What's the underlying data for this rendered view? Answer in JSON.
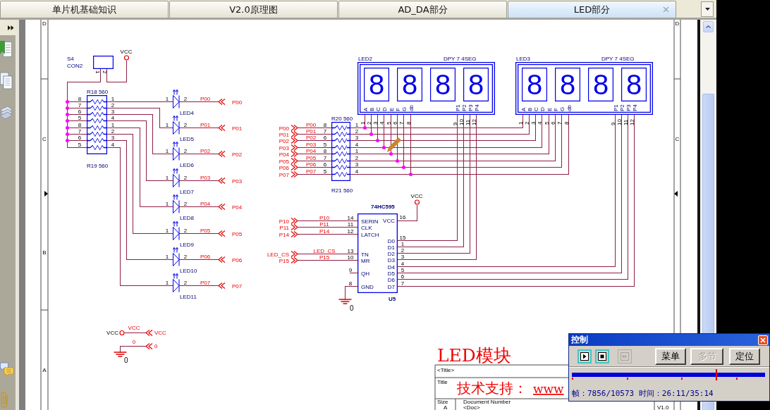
{
  "tabs": [
    {
      "label": "单片机基础知识",
      "selected": false
    },
    {
      "label": "V2.0原理图",
      "selected": false
    },
    {
      "label": "AD_DA部分",
      "selected": false
    },
    {
      "label": "LED部分",
      "selected": true
    }
  ],
  "schematic": {
    "zones": {
      "left": [
        "D",
        "C",
        "B",
        "A"
      ],
      "right": [
        "D",
        "C"
      ]
    },
    "connector": {
      "ref": "S4",
      "part": "CON2",
      "pins": [
        "1",
        "2"
      ],
      "power": "VCC"
    },
    "led_network": {
      "top_label": "R18 560",
      "bottom_label": "R19 560",
      "left_pins": [
        "8",
        "7",
        "6",
        "5",
        "8",
        "7",
        "6",
        "5"
      ],
      "right_pins": [
        "1",
        "2",
        "3",
        "4",
        "1",
        "2",
        "3",
        "4"
      ]
    },
    "leds": [
      {
        "ref": "LED4",
        "pin_a": "1",
        "pin_k": "2",
        "net": "P00",
        "port": "P00"
      },
      {
        "ref": "LED5",
        "pin_a": "1",
        "pin_k": "2",
        "net": "P01",
        "port": "P01"
      },
      {
        "ref": "LED6",
        "pin_a": "1",
        "pin_k": "2",
        "net": "P02",
        "port": "P02"
      },
      {
        "ref": "LED7",
        "pin_a": "1",
        "pin_k": "2",
        "net": "P03",
        "port": "P03"
      },
      {
        "ref": "LED8",
        "pin_a": "1",
        "pin_k": "2",
        "net": "P04",
        "port": "P04"
      },
      {
        "ref": "LED9",
        "pin_a": "1",
        "pin_k": "2",
        "net": "P05",
        "port": "P05"
      },
      {
        "ref": "LED10",
        "pin_a": "1",
        "pin_k": "2",
        "net": "P06",
        "port": "P06"
      },
      {
        "ref": "LED11",
        "pin_a": "1",
        "pin_k": "2",
        "net": "P07",
        "port": "P07"
      }
    ],
    "segment_network": {
      "top_label": "R20 560",
      "bottom_label": "R21 560",
      "left_pins": [
        "8",
        "7",
        "6",
        "5",
        "8",
        "7",
        "6",
        "5"
      ],
      "right_pins": [
        "1",
        "2",
        "3",
        "4",
        "1",
        "2",
        "3",
        "4"
      ]
    },
    "segment_inputs": [
      {
        "port": "P00",
        "net": "P00"
      },
      {
        "port": "P01",
        "net": "P01"
      },
      {
        "port": "P02",
        "net": "P02"
      },
      {
        "port": "P03",
        "net": "P03"
      },
      {
        "port": "P04",
        "net": "P04"
      },
      {
        "port": "P05",
        "net": "P05"
      },
      {
        "port": "P06",
        "net": "P06"
      },
      {
        "port": "P07",
        "net": "P07"
      }
    ],
    "displays": [
      {
        "ref": "LED2",
        "part": "DPY 7 4SEG",
        "digits": [
          "8",
          "8",
          "8",
          "8"
        ],
        "segment_pins": [
          "A",
          "B",
          "C",
          "D",
          "E",
          "F",
          "G",
          "db"
        ],
        "segment_numbers": [
          "1",
          "2",
          "3",
          "4",
          "5",
          "6",
          "7",
          "8"
        ],
        "digit_pins": [
          "P1",
          "P2",
          "P3",
          "P4"
        ],
        "digit_numbers": [
          "9",
          "10",
          "11",
          "12"
        ]
      },
      {
        "ref": "LED3",
        "part": "DPY 7 4SEG",
        "digits": [
          "8",
          "8",
          "8",
          "8"
        ],
        "segment_pins": [
          "A",
          "B",
          "C",
          "D",
          "E",
          "F",
          "G",
          "db"
        ],
        "segment_numbers": [
          "1",
          "2",
          "3",
          "4",
          "5",
          "6",
          "7",
          "8"
        ],
        "digit_pins": [
          "P1",
          "P2",
          "P3",
          "P4"
        ],
        "digit_numbers": [
          "9",
          "10",
          "11",
          "12"
        ]
      }
    ],
    "shift_register": {
      "part": "74HC595",
      "ref": "U5",
      "power": "VCC",
      "ground": "0",
      "inputs": [
        {
          "number": "14",
          "name": "SERIN",
          "net": "P10",
          "port": "P10"
        },
        {
          "number": "11",
          "name": "CLK",
          "net": "P11",
          "port": "P11"
        },
        {
          "number": "12",
          "name": "LATCH",
          "net": "P14",
          "port": "P14"
        },
        {
          "number": "13",
          "name": "TN",
          "net": "LED_CS",
          "port": "LED_CS"
        },
        {
          "number": "10",
          "name": "MR",
          "net": "P15",
          "port": "P15"
        },
        {
          "number": "9",
          "name": "QH"
        },
        {
          "number": "8",
          "name": "GND"
        }
      ],
      "supply_pin": {
        "number": "16",
        "name": "VCC"
      },
      "outputs": [
        {
          "number": "15",
          "name": "D0"
        },
        {
          "number": "1",
          "name": "D1"
        },
        {
          "number": "2",
          "name": "D2"
        },
        {
          "number": "3",
          "name": "D3"
        },
        {
          "number": "4",
          "name": "D4"
        },
        {
          "number": "5",
          "name": "D5"
        },
        {
          "number": "6",
          "name": "D6"
        },
        {
          "number": "7",
          "name": "D7"
        }
      ]
    },
    "power_symbols": [
      {
        "kind": "vcc",
        "symbol": "VCC",
        "net": "VCC",
        "port": "VCC"
      },
      {
        "kind": "ground",
        "symbol": "0",
        "net": "0",
        "port": "0"
      }
    ],
    "title_block": {
      "heading": "LED模块",
      "title_value": "<Title>",
      "title_label": "Title",
      "support": "技术支持：",
      "link": "www",
      "size_label": "Size",
      "size": "A",
      "number_label": "Document Number",
      "number": "<Doc>",
      "revision": "V1.0"
    }
  },
  "control_panel": {
    "title": "控制",
    "buttons": [
      {
        "kind": "play",
        "disabled": false
      },
      {
        "kind": "stop",
        "disabled": false
      },
      {
        "kind": "step",
        "disabled": true
      },
      {
        "kind": "text",
        "label": "菜单",
        "disabled": false
      },
      {
        "kind": "text",
        "label": "多节",
        "disabled": true
      },
      {
        "kind": "text",
        "label": "定位",
        "disabled": false
      }
    ],
    "progress": {
      "level": 0.743
    },
    "status": "帧：7856/10573 时间：26:11/35:14"
  }
}
